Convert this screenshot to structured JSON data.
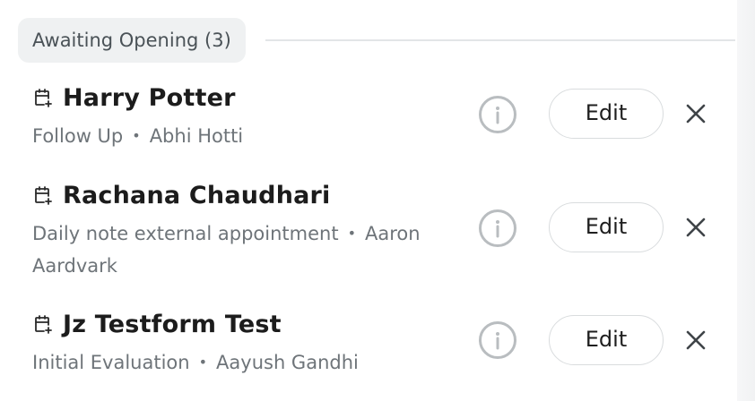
{
  "section": {
    "label": "Awaiting Opening (3)"
  },
  "appointments": [
    {
      "name": "Harry Potter",
      "type": "Follow Up",
      "provider": "Abhi Hotti",
      "edit_label": "Edit"
    },
    {
      "name": "Rachana Chaudhari",
      "type": "Daily note external appointment",
      "provider": "Aaron Aardvark",
      "edit_label": "Edit"
    },
    {
      "name": "Jz Testform Test",
      "type": "Initial Evaluation",
      "provider": "Aayush Gandhi",
      "edit_label": "Edit"
    }
  ],
  "separator": "•",
  "icons": {
    "calendar": "calendar-plus-icon",
    "info": "info-circle-icon",
    "close": "close-icon"
  },
  "colors": {
    "pill_bg": "#eff1f2",
    "meta_text": "#6e7479",
    "info_icon": "#b9bdc0",
    "close_icon": "#3f4448"
  }
}
